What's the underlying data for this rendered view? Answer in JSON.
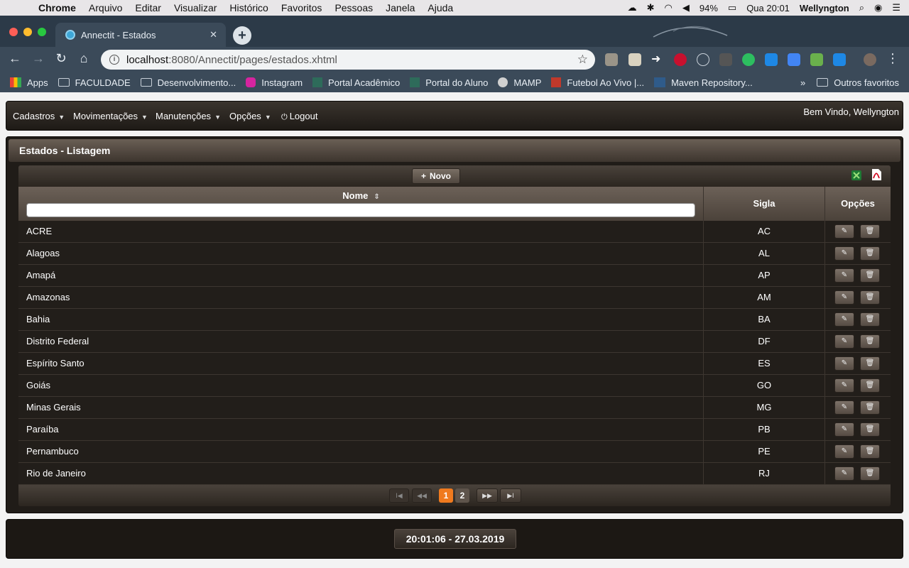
{
  "macos_menu": {
    "app": "Chrome",
    "items": [
      "Arquivo",
      "Editar",
      "Visualizar",
      "Histórico",
      "Favoritos",
      "Pessoas",
      "Janela",
      "Ajuda"
    ],
    "battery": "94%",
    "clock": "Qua 20:01",
    "user": "Wellyngton"
  },
  "browser": {
    "tab_title": "Annectit - Estados",
    "url_host": "localhost",
    "url_path": ":8080/Annectit/pages/estados.xhtml",
    "bookmarks": [
      {
        "label": "Apps",
        "icon": "apps-grid-icon"
      },
      {
        "label": "FACULDADE",
        "icon": "folder-icon"
      },
      {
        "label": "Desenvolvimento...",
        "icon": "folder-icon"
      },
      {
        "label": "Instagram",
        "icon": "instagram-icon"
      },
      {
        "label": "Portal Acadêmico",
        "icon": "portal-icon"
      },
      {
        "label": "Portal do Aluno",
        "icon": "portal-icon"
      },
      {
        "label": "MAMP",
        "icon": "mamp-icon"
      },
      {
        "label": "Futebol Ao Vivo |...",
        "icon": "futebol-icon"
      },
      {
        "label": "Maven Repository...",
        "icon": "maven-icon"
      }
    ],
    "bookmarks_overflow": "»",
    "other_bookmarks": "Outros favoritos"
  },
  "topmenu": {
    "items": [
      "Cadastros",
      "Movimentações",
      "Manutenções",
      "Opções"
    ],
    "logout": "Logout",
    "welcome": "Bem Vindo, Wellyngton"
  },
  "panel": {
    "title": "Estados - Listagem",
    "new_button": "Novo",
    "columns": {
      "nome": "Nome",
      "sigla": "Sigla",
      "opcoes": "Opções"
    },
    "filter_value": "",
    "rows": [
      {
        "nome": "ACRE",
        "sigla": "AC"
      },
      {
        "nome": "Alagoas",
        "sigla": "AL"
      },
      {
        "nome": "Amapá",
        "sigla": "AP"
      },
      {
        "nome": "Amazonas",
        "sigla": "AM"
      },
      {
        "nome": "Bahia",
        "sigla": "BA"
      },
      {
        "nome": "Distrito Federal",
        "sigla": "DF"
      },
      {
        "nome": "Espírito Santo",
        "sigla": "ES"
      },
      {
        "nome": "Goiás",
        "sigla": "GO"
      },
      {
        "nome": "Minas Gerais",
        "sigla": "MG"
      },
      {
        "nome": "Paraíba",
        "sigla": "PB"
      },
      {
        "nome": "Pernambuco",
        "sigla": "PE"
      },
      {
        "nome": "Rio de Janeiro",
        "sigla": "RJ"
      }
    ],
    "pagination": {
      "pages": [
        "1",
        "2"
      ],
      "current": "1"
    }
  },
  "footer": {
    "datetime": "20:01:06 - 27.03.2019"
  },
  "colors": {
    "accent_page": "#f07a1e",
    "panel_bg": "#201c18",
    "tabstrip": "#2c3a48"
  }
}
